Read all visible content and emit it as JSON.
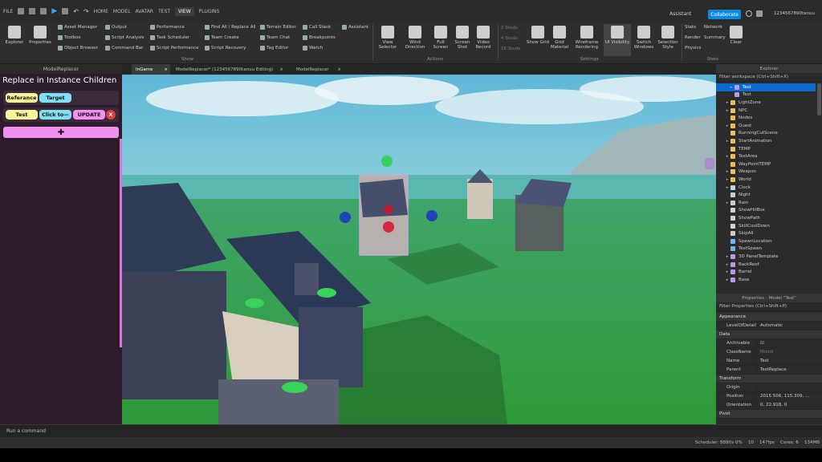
{
  "menubar": {
    "file": "FILE",
    "tabs": [
      "HOME",
      "MODEL",
      "AVATAR",
      "TEST",
      "VIEW",
      "PLUGINS"
    ],
    "active_tab": "VIEW",
    "assistant": "Assistant",
    "collaborate": "Collaborate",
    "username": "1234567890tanuu"
  },
  "ribbon": {
    "explorer": "Explorer",
    "properties": "Properties",
    "col1": [
      "Asset Manager",
      "Toolbox",
      "Object Browser"
    ],
    "col2": [
      "Output",
      "Script Analysis",
      "Command Bar"
    ],
    "col3": [
      "Performance",
      "Task Scheduler",
      "Script Performance"
    ],
    "col4": [
      "Find All / Replace All",
      "Team Create",
      "Script Recovery"
    ],
    "col5": [
      "Terrain Editor",
      "Team Chat",
      "Tag Editor"
    ],
    "col6": [
      "Call Stack",
      "Breakpoints",
      "Watch"
    ],
    "assistant": "Assistant",
    "group_show": "Show",
    "actions": [
      "View Selector",
      "Wind Direction",
      "Full Screen",
      "Screen Shot",
      "Video Record"
    ],
    "group_actions": "Actions",
    "studs": [
      "2 Studs",
      "4 Studs",
      "16 Studs"
    ],
    "settings": [
      "Show Grid",
      "Grid Material",
      "Wireframe Rendering",
      "UI Visibility",
      "Switch Windows",
      "Selection Style"
    ],
    "group_settings": "Settings",
    "stats": [
      "Stats",
      "Network",
      "Render",
      "Summary",
      "Physics"
    ],
    "clear": "Clear",
    "group_stats": "Stats"
  },
  "doc_tabs": [
    "InGame",
    "ModelReplacer* (1234567890tanuu Editing)",
    "ModelReplacer"
  ],
  "plugin": {
    "panel_title": "ModelReplacer",
    "heading": "Replace in Instance Children",
    "btn_reference": "Referance",
    "btn_target": "Target",
    "btn_test": "Test",
    "btn_click": "Click to—",
    "btn_update": "UPDATE",
    "btn_close": "X",
    "btn_add": "✚"
  },
  "explorer": {
    "title": "Explorer",
    "filter": "Filter workspace (Ctrl+Shift+X)",
    "items": [
      {
        "name": "Test",
        "indent": 3,
        "arrow": "▸",
        "icon": "model",
        "selected": true
      },
      {
        "name": "Test",
        "indent": 3,
        "arrow": "",
        "icon": "model",
        "selected": false
      },
      {
        "name": "LightZone",
        "indent": 2,
        "arrow": "▸",
        "icon": "folder",
        "selected": false
      },
      {
        "name": "NPC",
        "indent": 2,
        "arrow": "▸",
        "icon": "folder",
        "selected": false
      },
      {
        "name": "Nodes",
        "indent": 2,
        "arrow": "",
        "icon": "folder",
        "selected": false
      },
      {
        "name": "Quest",
        "indent": 2,
        "arrow": "▸",
        "icon": "folder",
        "selected": false
      },
      {
        "name": "RunningCutScene",
        "indent": 2,
        "arrow": "",
        "icon": "folder",
        "selected": false
      },
      {
        "name": "StartAnimation",
        "indent": 2,
        "arrow": "▸",
        "icon": "folder",
        "selected": false
      },
      {
        "name": "TEMP",
        "indent": 2,
        "arrow": "",
        "icon": "folder",
        "selected": false
      },
      {
        "name": "TestArea",
        "indent": 2,
        "arrow": "▸",
        "icon": "folder",
        "selected": false
      },
      {
        "name": "WayPointTEMP",
        "indent": 2,
        "arrow": "",
        "icon": "folder",
        "selected": false
      },
      {
        "name": "Weapon",
        "indent": 2,
        "arrow": "▸",
        "icon": "folder",
        "selected": false
      },
      {
        "name": "World",
        "indent": 2,
        "arrow": "▸",
        "icon": "folder",
        "selected": false
      },
      {
        "name": "Clock",
        "indent": 2,
        "arrow": "▸",
        "icon": "value",
        "selected": false
      },
      {
        "name": "Night",
        "indent": 2,
        "arrow": "",
        "icon": "value",
        "selected": false
      },
      {
        "name": "Rain",
        "indent": 2,
        "arrow": "▸",
        "icon": "value",
        "selected": false
      },
      {
        "name": "ShowHitBox",
        "indent": 2,
        "arrow": "",
        "icon": "value",
        "selected": false
      },
      {
        "name": "ShowPath",
        "indent": 2,
        "arrow": "",
        "icon": "value",
        "selected": false
      },
      {
        "name": "SkillCoolDown",
        "indent": 2,
        "arrow": "",
        "icon": "value",
        "selected": false
      },
      {
        "name": "SkipAll",
        "indent": 2,
        "arrow": "",
        "icon": "value",
        "selected": false
      },
      {
        "name": "SpawnLocation",
        "indent": 2,
        "arrow": "",
        "icon": "spawn",
        "selected": false
      },
      {
        "name": "TestSpawn",
        "indent": 2,
        "arrow": "",
        "icon": "spawn",
        "selected": false
      },
      {
        "name": "3D PanelTemplate",
        "indent": 2,
        "arrow": "▸",
        "icon": "model",
        "selected": false
      },
      {
        "name": "BackRoof",
        "indent": 2,
        "arrow": "▸",
        "icon": "model",
        "selected": false
      },
      {
        "name": "Barrel",
        "indent": 2,
        "arrow": "▸",
        "icon": "model",
        "selected": false
      },
      {
        "name": "Base",
        "indent": 2,
        "arrow": "▸",
        "icon": "model",
        "selected": false
      }
    ]
  },
  "properties": {
    "title": "Properties - Model \"Test\"",
    "filter": "Filter Properties (Ctrl+Shift+P)",
    "rows": [
      {
        "cat": true,
        "key": "Appearance",
        "val": ""
      },
      {
        "cat": false,
        "key": "LevelOfDetail",
        "val": "Automatic"
      },
      {
        "cat": true,
        "key": "Data",
        "val": ""
      },
      {
        "cat": false,
        "key": "Archivable",
        "val": "☑"
      },
      {
        "cat": false,
        "key": "ClassName",
        "val": "Model"
      },
      {
        "cat": false,
        "key": "Name",
        "val": "Test"
      },
      {
        "cat": false,
        "key": "Parent",
        "val": "TestReplace"
      },
      {
        "cat": true,
        "key": "Transform",
        "val": ""
      },
      {
        "cat": false,
        "key": "Origin",
        "val": ""
      },
      {
        "cat": false,
        "key": "Position",
        "val": "2015.506, 115.309, ..."
      },
      {
        "cat": false,
        "key": "Orientation",
        "val": "0, 22.918, 0"
      },
      {
        "cat": true,
        "key": "Pivot",
        "val": ""
      }
    ]
  },
  "command_bar": "Run a command",
  "status": {
    "scheduler": "Scheduler: 889f/s 0%",
    "a": "10",
    "fps": "147fps",
    "cores": "Cores: 6",
    "mem": "134MB"
  },
  "colors": {
    "selected": "#0b6ad0",
    "collaborate": "#0b8ae0",
    "pill_yellow": "#f7f59a",
    "pill_cyan": "#7ee0f2",
    "pill_pink": "#f28ff0",
    "close_red": "#e23c3c"
  }
}
